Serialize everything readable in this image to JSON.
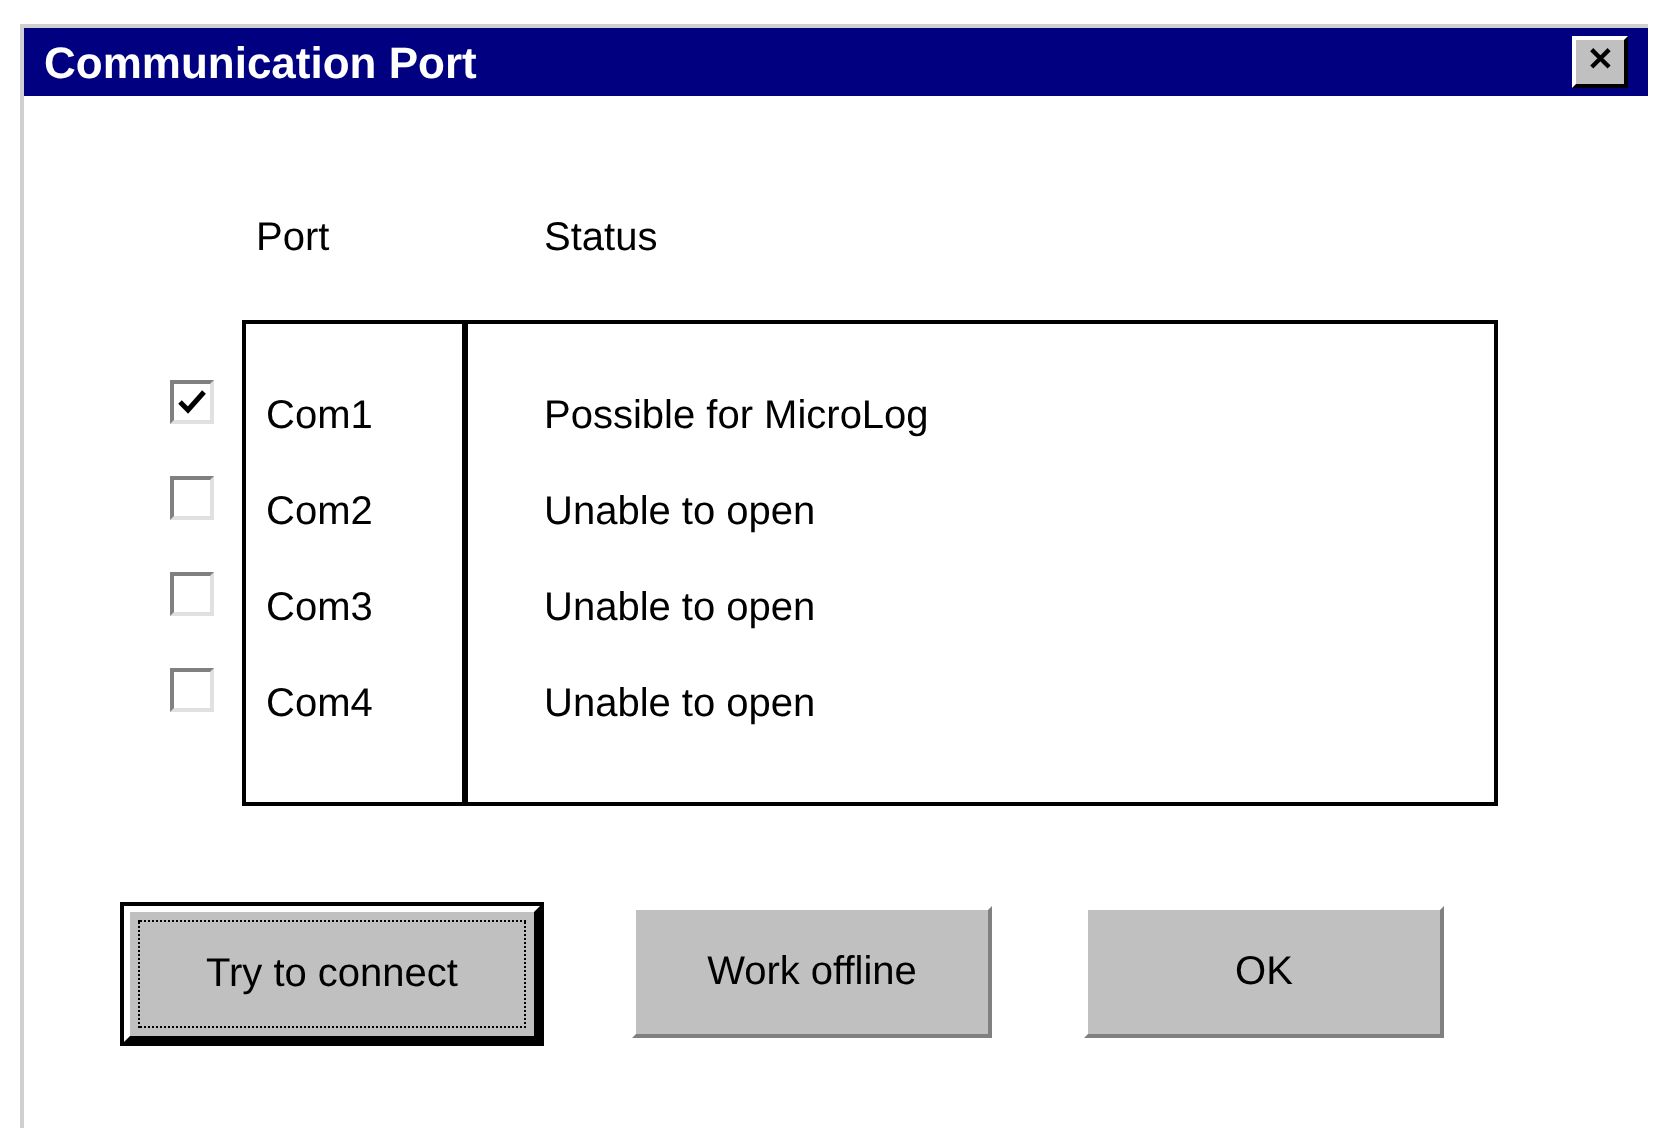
{
  "window": {
    "title": "Communication Port",
    "close": "✕"
  },
  "columns": [
    "Port",
    "Status"
  ],
  "rows": [
    {
      "port": "Com1",
      "status": "Possible for MicroLog",
      "checked": true
    },
    {
      "port": "Com2",
      "status": "Unable to open",
      "checked": false
    },
    {
      "port": "Com3",
      "status": "Unable to open",
      "checked": false
    },
    {
      "port": "Com4",
      "status": "Unable to open",
      "checked": false
    }
  ],
  "buttons": [
    {
      "label": "Try to connect",
      "focused": true
    },
    {
      "label": "Work offline",
      "focused": false
    },
    {
      "label": "OK",
      "focused": false
    }
  ]
}
